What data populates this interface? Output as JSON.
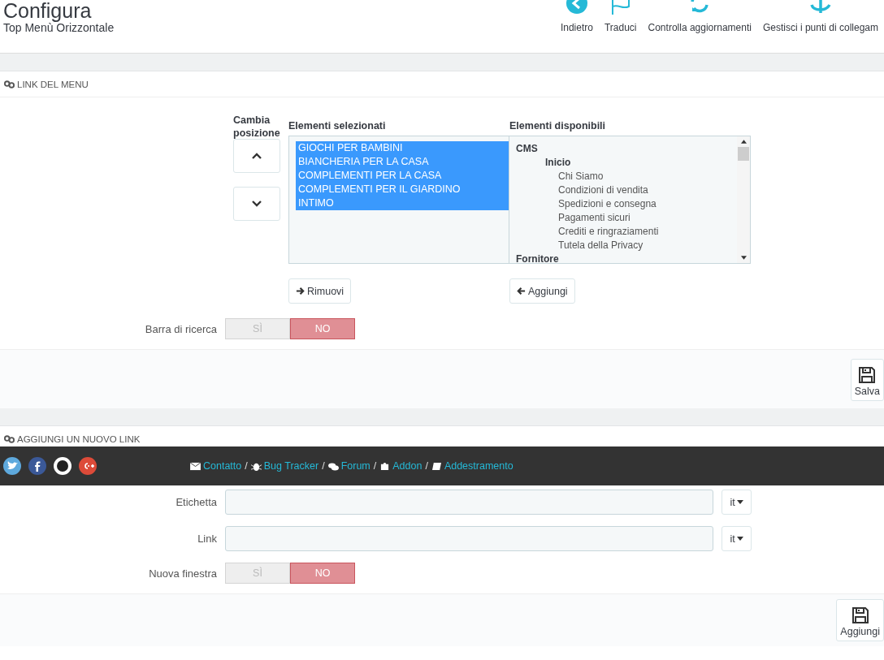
{
  "header": {
    "title": "Configura",
    "subtitle": "Top Menù Orizzontale",
    "toolbar": [
      {
        "label": "Indietro",
        "kind": "back"
      },
      {
        "label": "Traduci",
        "kind": "flag"
      },
      {
        "label": "Controlla aggiornamenti",
        "kind": "refresh"
      },
      {
        "label": "Gestisci i punti di collegam",
        "kind": "anchor"
      }
    ]
  },
  "menu_links_panel": {
    "heading": "LINK DEL MENU",
    "position_label": "Cambia posizione",
    "selected_heading": "Elementi selezionati",
    "available_heading": "Elementi disponibili",
    "selected_items": [
      {
        "label": "GIOCHI PER BAMBINI",
        "selected": true
      },
      {
        "label": "BIANCHERIA PER LA CASA",
        "selected": true
      },
      {
        "label": "COMPLEMENTI PER LA CASA",
        "selected": true
      },
      {
        "label": "COMPLEMENTI PER IL GIARDINO",
        "selected": true
      },
      {
        "label": "INTIMO",
        "selected": true
      }
    ],
    "available_items": [
      {
        "label": "CMS",
        "children": [
          {
            "label": "Inicio",
            "children": [
              {
                "label": "Chi Siamo"
              },
              {
                "label": "Condizioni di vendita"
              },
              {
                "label": "Spedizioni e consegna"
              },
              {
                "label": "Pagamenti sicuri"
              },
              {
                "label": "Crediti e ringraziamenti"
              },
              {
                "label": "Tutela della Privacy"
              }
            ]
          }
        ]
      },
      {
        "label": "Fornitore"
      }
    ],
    "remove_button": "Rimuovi",
    "add_button": "Aggiungi",
    "search_bar": {
      "label": "Barra di ricerca",
      "options": [
        {
          "label": "SÌ",
          "selected": false
        },
        {
          "label": "NO",
          "selected": true
        }
      ]
    },
    "save_button": "Salva"
  },
  "new_link_panel": {
    "heading": "AGGIUNGI UN NUOVO LINK",
    "fields": [
      {
        "label": "Etichetta",
        "language": "it"
      },
      {
        "label": "Link",
        "language": "it"
      }
    ],
    "new_window": {
      "label": "Nuova finestra",
      "options": [
        {
          "label": "SÌ",
          "selected": false
        },
        {
          "label": "NO",
          "selected": true
        }
      ]
    },
    "add_button": "Aggiungi"
  },
  "footer_bar": {
    "separator": "/",
    "links": [
      {
        "label": "Contatto",
        "kind": "mail"
      },
      {
        "label": "Bug Tracker",
        "kind": "bug"
      },
      {
        "label": "Forum",
        "kind": "chat"
      },
      {
        "label": "Addon",
        "kind": "puzzle"
      },
      {
        "label": "Addestramento",
        "kind": "book"
      }
    ]
  }
}
